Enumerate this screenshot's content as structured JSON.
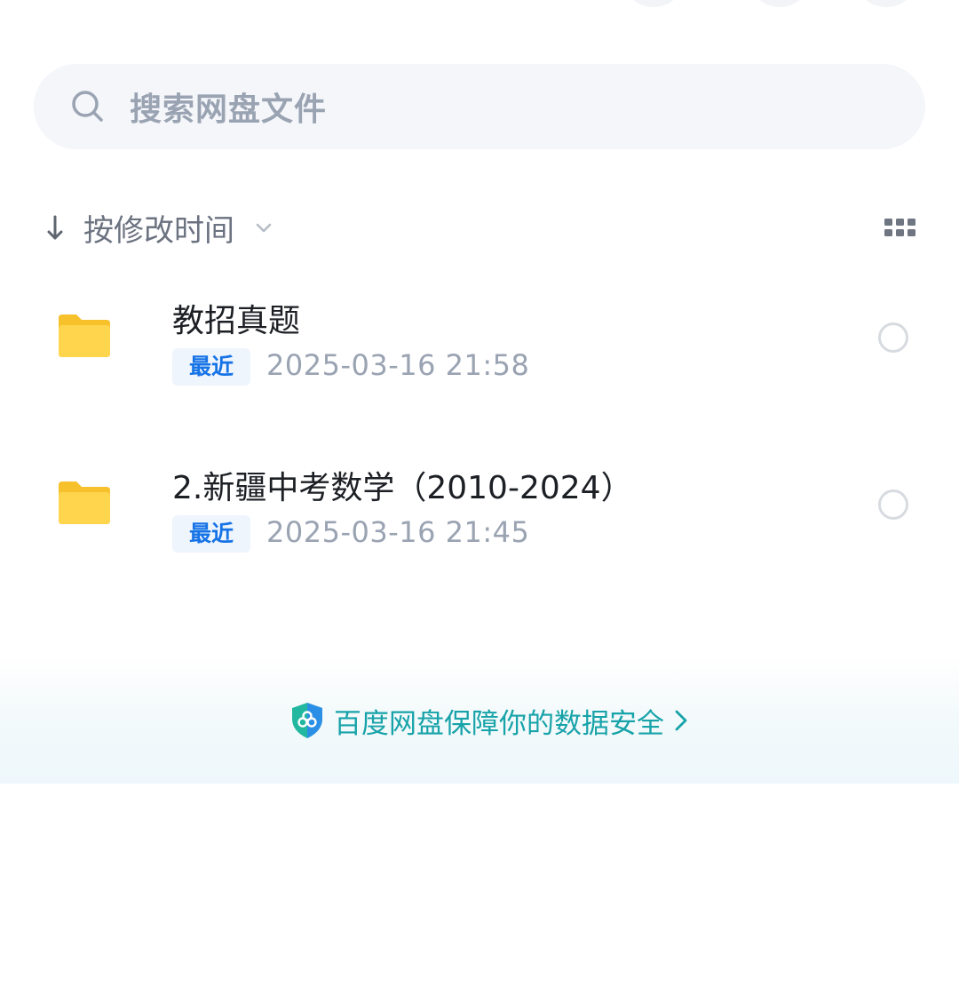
{
  "search": {
    "placeholder": "搜索网盘文件",
    "icon": "search-icon"
  },
  "sort": {
    "label": "按修改时间",
    "direction_icon": "arrow-down-icon",
    "dropdown_icon": "chevron-down-icon",
    "view_toggle_icon": "grid-view-icon"
  },
  "files": [
    {
      "name": "教招真题",
      "badge": "最近",
      "modified": "2025-03-16  21:58",
      "icon": "folder-icon"
    },
    {
      "name": "2.新疆中考数学（2010-2024）",
      "badge": "最近",
      "modified": "2025-03-16  21:45",
      "icon": "folder-icon"
    }
  ],
  "security": {
    "text": "百度网盘保障你的数据安全",
    "icon": "shield-icon",
    "chevron_icon": "chevron-right-icon"
  },
  "colors": {
    "folder": "#ffd04b",
    "badge_text": "#1673e6",
    "badge_bg": "#eef5fd",
    "security_text": "#17a3a9",
    "muted": "#9aa3b2"
  }
}
